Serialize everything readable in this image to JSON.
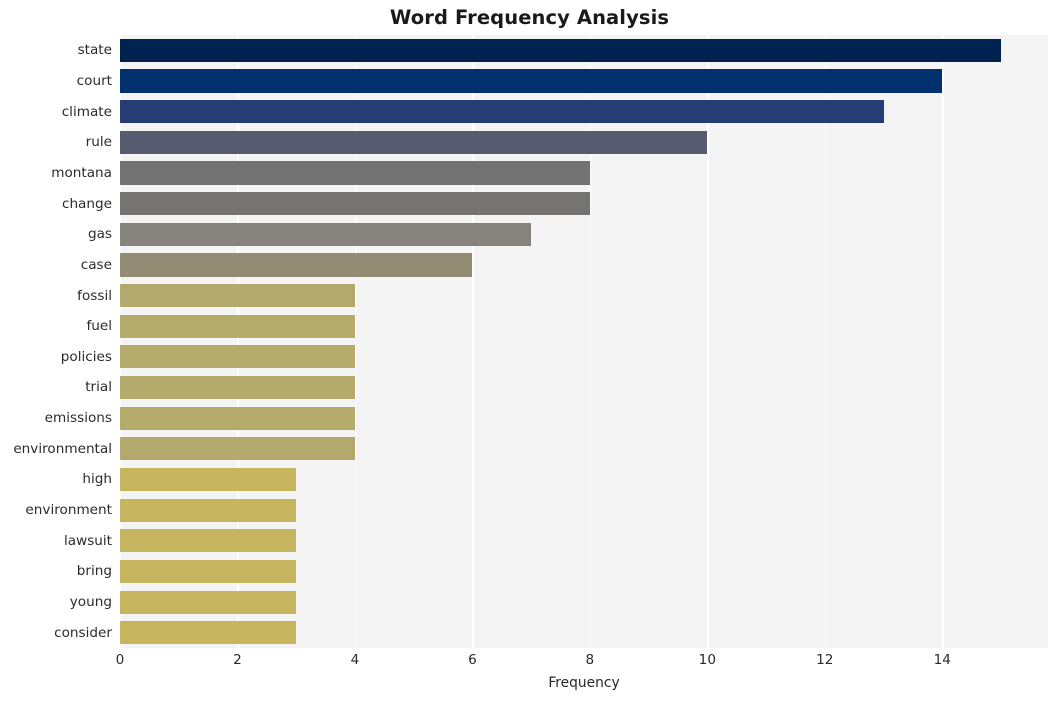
{
  "chart_data": {
    "type": "bar",
    "orientation": "horizontal",
    "title": "Word Frequency Analysis",
    "xlabel": "Frequency",
    "ylabel": "",
    "categories": [
      "state",
      "court",
      "climate",
      "rule",
      "montana",
      "change",
      "gas",
      "case",
      "fossil",
      "fuel",
      "policies",
      "trial",
      "emissions",
      "environmental",
      "high",
      "environment",
      "lawsuit",
      "bring",
      "young",
      "consider"
    ],
    "values": [
      15,
      14,
      13,
      10,
      8,
      8,
      7,
      6,
      4,
      4,
      4,
      4,
      4,
      4,
      3,
      3,
      3,
      3,
      3,
      3
    ],
    "xlim": [
      0,
      15.8
    ],
    "xticks": [
      0,
      2,
      4,
      6,
      8,
      10,
      12,
      14
    ],
    "xtick_labels": [
      "0",
      "2",
      "4",
      "6",
      "8",
      "10",
      "12",
      "14"
    ],
    "grid": true,
    "grid_axis": "x",
    "legend": "none",
    "style": "whitegrid",
    "plot_background": "#f4f4f5",
    "gridline_color": "#ffffff",
    "bar_colors": [
      "#00224e",
      "#00306e",
      "#253c75",
      "#565b70",
      "#727272",
      "#757473",
      "#85837c",
      "#918c73",
      "#b2a96e",
      "#b5ab6b",
      "#b5ab6b",
      "#b4aa6c",
      "#b5ab6b",
      "#b3a96d",
      "#c6b45e",
      "#c6b45e",
      "#c6b45e",
      "#c6b45e",
      "#c6b45e",
      "#c6b45e"
    ]
  }
}
